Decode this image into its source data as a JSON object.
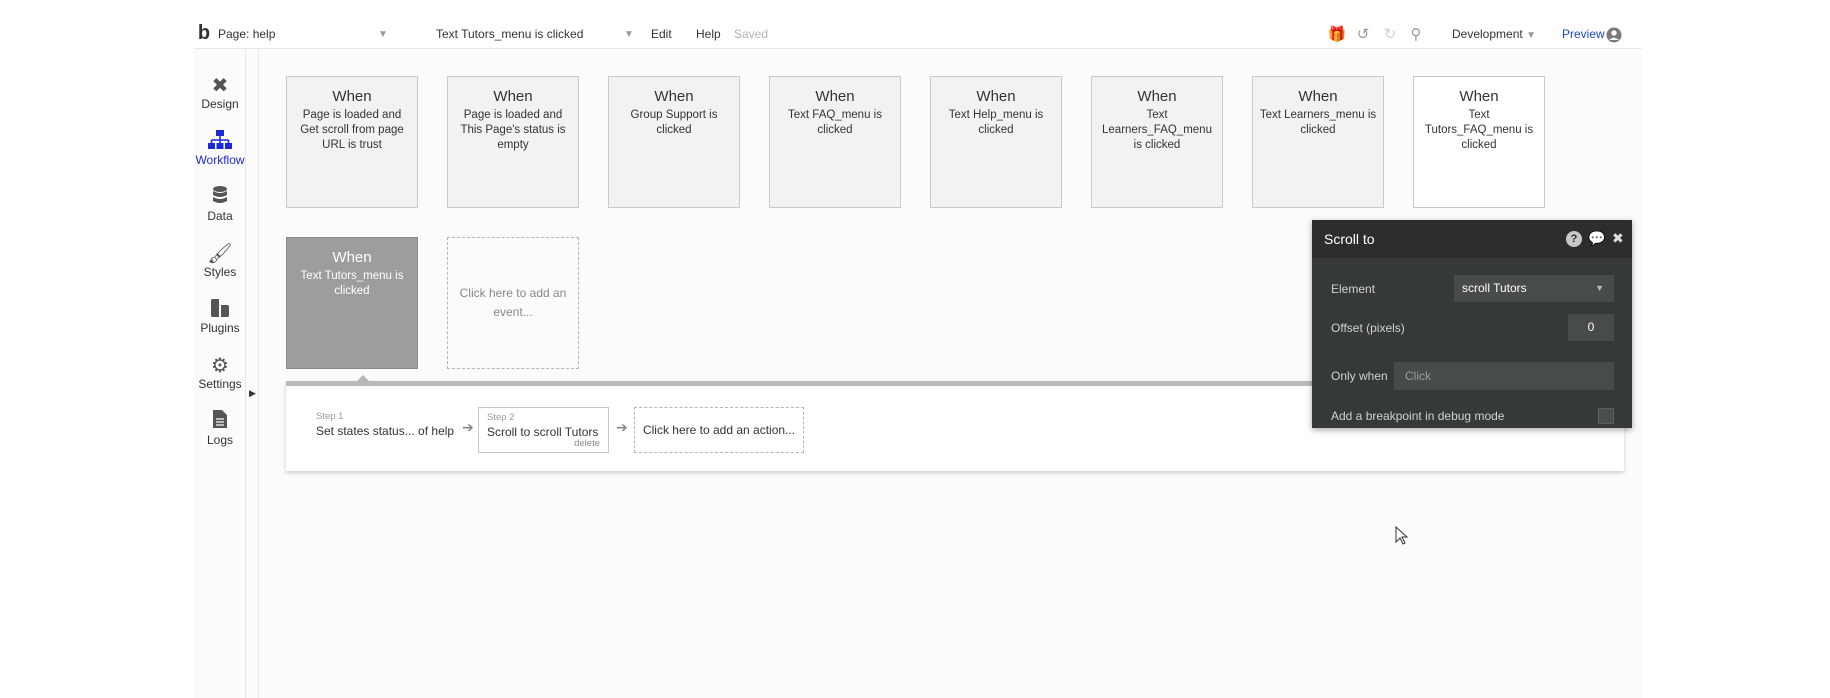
{
  "topbar": {
    "logo": "b",
    "page_select": "Page: help",
    "event_select": "Text Tutors_menu is clicked",
    "menu_edit": "Edit",
    "menu_help": "Help",
    "save_state": "Saved",
    "environment": "Development",
    "preview": "Preview"
  },
  "sidenav": {
    "items": [
      {
        "label": "Design",
        "icon": "design-icon"
      },
      {
        "label": "Workflow",
        "icon": "workflow-icon"
      },
      {
        "label": "Data",
        "icon": "database-icon"
      },
      {
        "label": "Styles",
        "icon": "brush-icon"
      },
      {
        "label": "Plugins",
        "icon": "plug-icon"
      },
      {
        "label": "Settings",
        "icon": "gear-icon"
      },
      {
        "label": "Logs",
        "icon": "document-icon"
      }
    ]
  },
  "events": [
    {
      "when": "When",
      "condition": "Page is loaded and Get scroll from page URL is trust"
    },
    {
      "when": "When",
      "condition": "Page is loaded and This Page's status is empty"
    },
    {
      "when": "When",
      "condition": "Group Support is clicked"
    },
    {
      "when": "When",
      "condition": "Text FAQ_menu is clicked"
    },
    {
      "when": "When",
      "condition": "Text Help_menu is clicked"
    },
    {
      "when": "When",
      "condition": "Text Learners_FAQ_menu is clicked"
    },
    {
      "when": "When",
      "condition": "Text Learners_menu is clicked"
    },
    {
      "when": "When",
      "condition": "Text Tutors_FAQ_menu is clicked"
    },
    {
      "when": "When",
      "condition": "Text Tutors_menu is clicked"
    }
  ],
  "add_event": "Click here to add an event...",
  "steps": [
    {
      "number": "Step 1",
      "title": "Set states status... of help"
    },
    {
      "number": "Step 2",
      "title": "Scroll to scroll Tutors",
      "delete": "delete"
    }
  ],
  "add_action": "Click here to add an action...",
  "panel": {
    "title": "Scroll to",
    "element_label": "Element",
    "element_value": "scroll Tutors",
    "offset_label": "Offset (pixels)",
    "offset_value": "0",
    "only_when_label": "Only when",
    "only_when_placeholder": "Click",
    "breakpoint_label": "Add a breakpoint in debug mode"
  }
}
